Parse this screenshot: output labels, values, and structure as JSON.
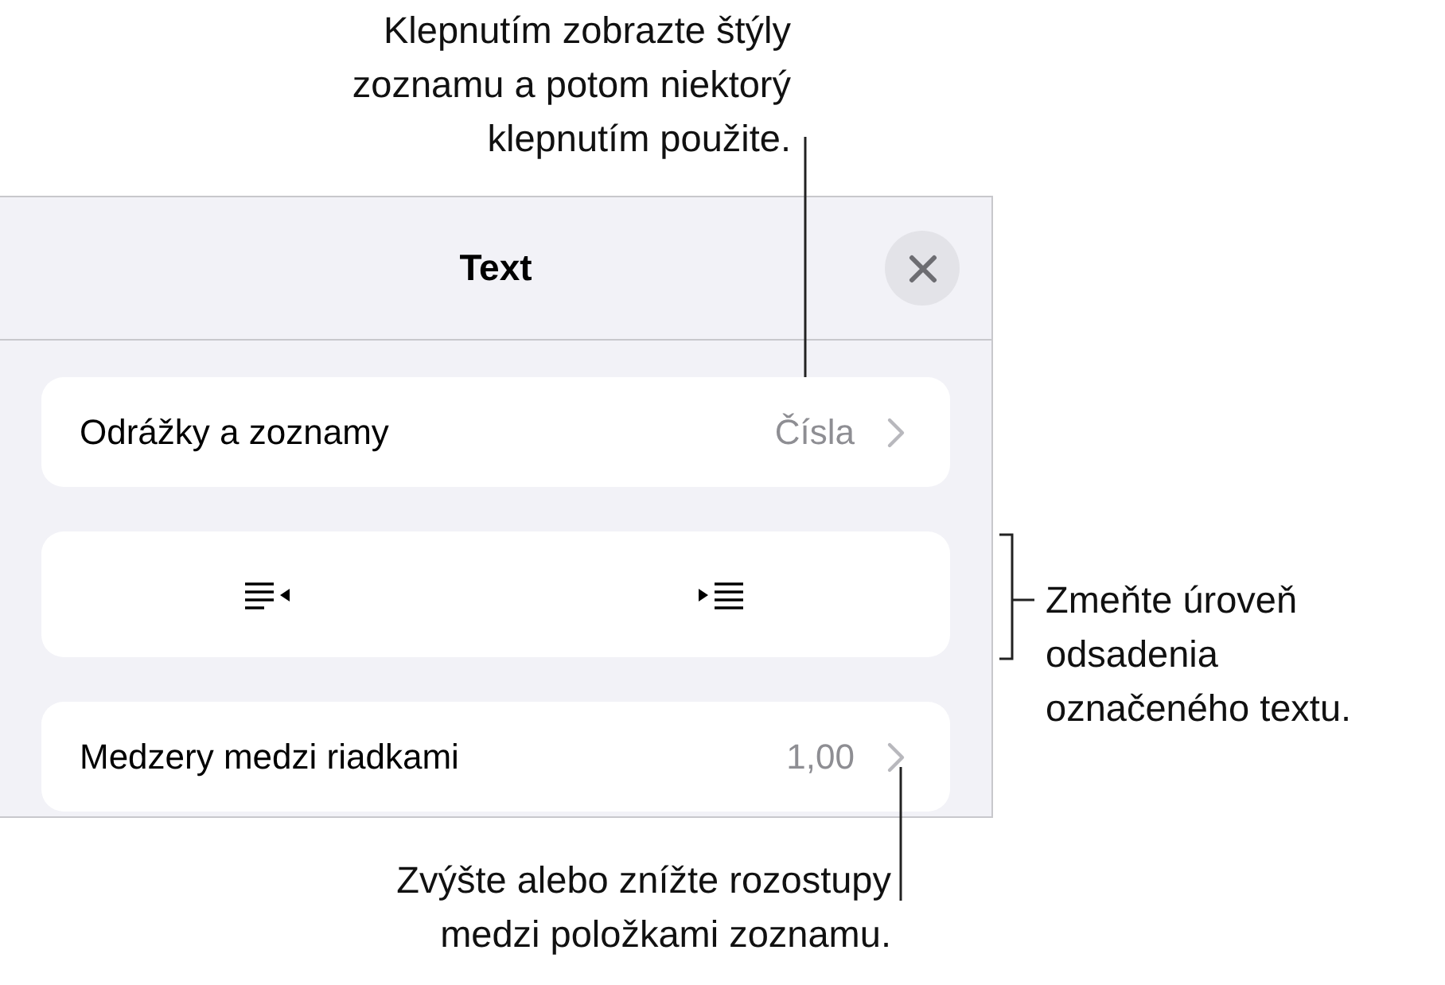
{
  "panel": {
    "title": "Text",
    "rows": [
      {
        "kind": "nav",
        "label": "Odrážky a zoznamy",
        "value": "Čísla"
      },
      {
        "kind": "indent"
      },
      {
        "kind": "nav",
        "label": "Medzery medzi riadkami",
        "value": "1,00"
      }
    ]
  },
  "callouts": [
    {
      "kind": "top",
      "text": "Klepnutím zobrazte štýly\nzoznamu a potom niektorý\nklepnutím použite."
    },
    {
      "kind": "right",
      "text": "Zmeňte úroveň\nodsadenia\noznačeného textu."
    },
    {
      "kind": "bottom",
      "text": "Zvýšte alebo znížte rozostupy\nmedzi položkami zoznamu."
    }
  ]
}
